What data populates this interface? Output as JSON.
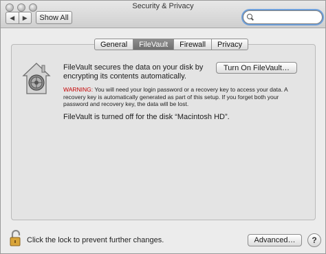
{
  "window": {
    "title": "Security & Privacy",
    "back_glyph": "◀",
    "forward_glyph": "▶",
    "show_all_label": "Show All"
  },
  "search": {
    "value": "",
    "placeholder": ""
  },
  "tabs": [
    {
      "label": "General",
      "active": false
    },
    {
      "label": "FileVault",
      "active": true
    },
    {
      "label": "Firewall",
      "active": false
    },
    {
      "label": "Privacy",
      "active": false
    }
  ],
  "filevault": {
    "description": "FileVault secures the data on your disk by encrypting its contents automatically.",
    "turn_on_label": "Turn On FileVault…",
    "warning_label": "WARNING:",
    "warning_text": " You will need your login password or a recovery key to access your data. A recovery key is automatically generated as part of this setup. If you forget both your password and recovery key, the data will be lost.",
    "status": "FileVault is turned off for the disk “Macintosh HD”."
  },
  "footer": {
    "lock_text": "Click the lock to prevent further changes.",
    "advanced_label": "Advanced…",
    "help_label": "?"
  },
  "colors": {
    "warning": "#c40000",
    "focus_ring": "#6ea0dc",
    "active_tab": "#7a7a7a"
  },
  "icons": {
    "house": "filevault-house-icon",
    "lock": "unlocked-padlock-icon",
    "search": "magnifier-icon"
  }
}
